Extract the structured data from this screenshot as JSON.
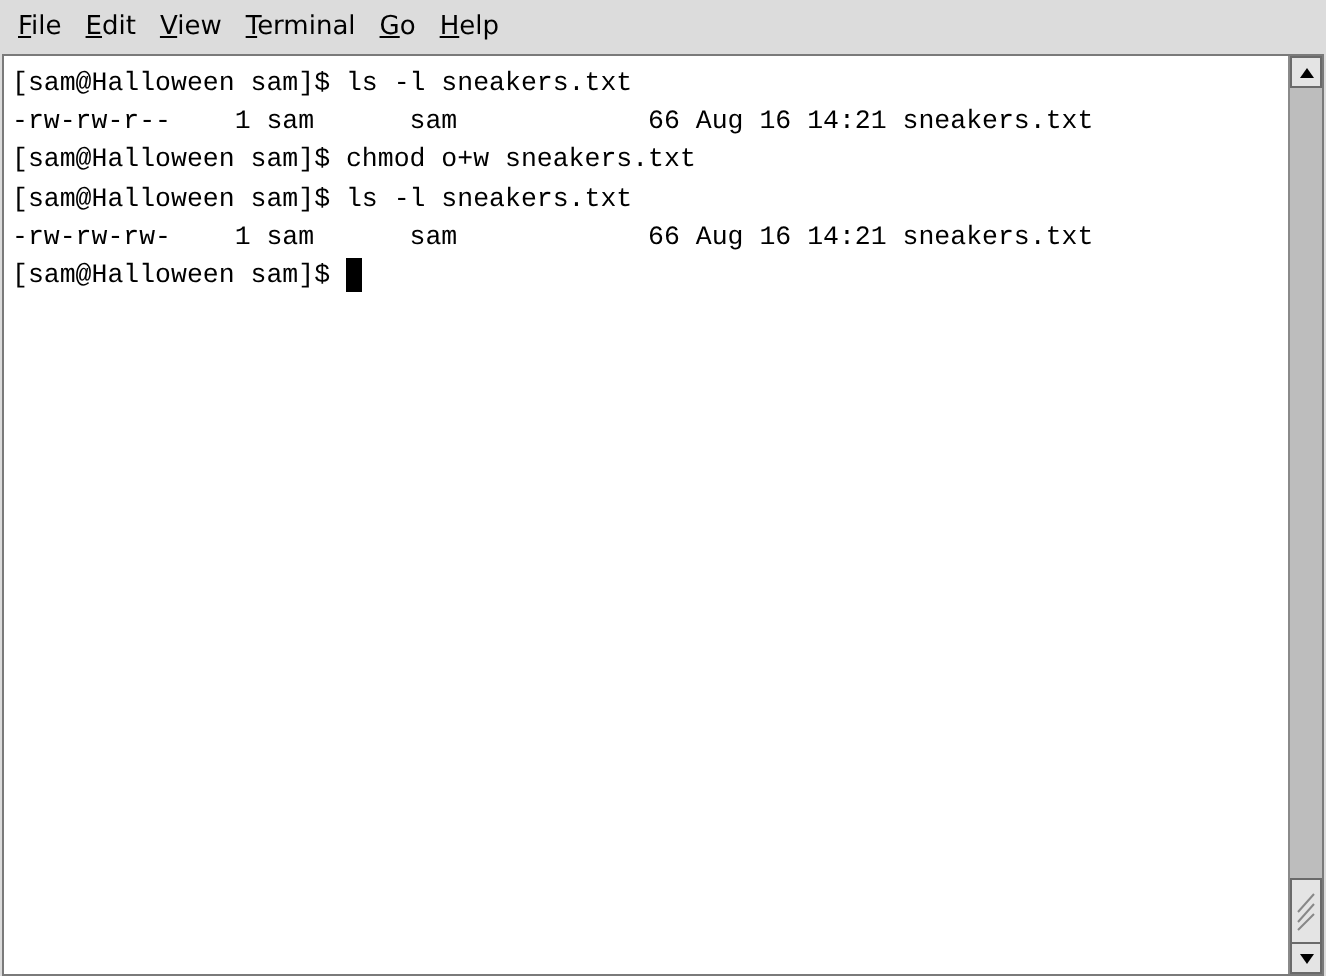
{
  "menu": [
    {
      "label": "File"
    },
    {
      "label": "Edit"
    },
    {
      "label": "View"
    },
    {
      "label": "Terminal"
    },
    {
      "label": "Go"
    },
    {
      "label": "Help"
    }
  ],
  "terminal": {
    "lines": [
      "[sam@Halloween sam]$ ls -l sneakers.txt",
      "-rw-rw-r--    1 sam      sam            66 Aug 16 14:21 sneakers.txt",
      "[sam@Halloween sam]$ chmod o+w sneakers.txt",
      "[sam@Halloween sam]$ ls -l sneakers.txt",
      "-rw-rw-rw-    1 sam      sam            66 Aug 16 14:21 sneakers.txt",
      "[sam@Halloween sam]$ "
    ]
  }
}
